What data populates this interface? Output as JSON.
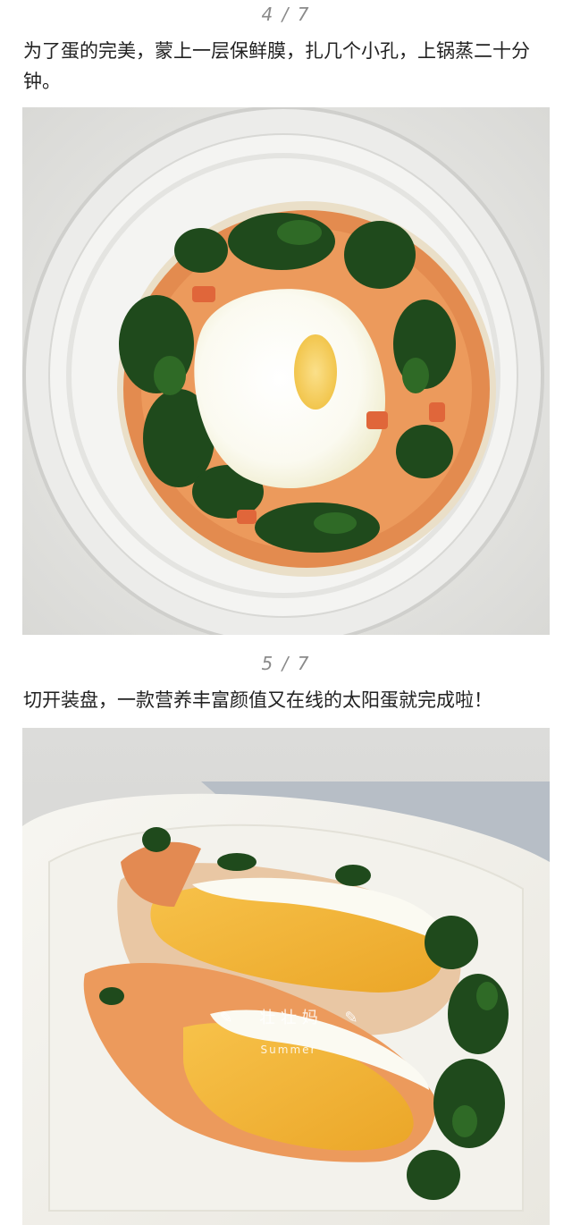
{
  "steps": [
    {
      "counter": "4 / 7",
      "text": "为了蛋的完美，蒙上一层保鲜膜，扎几个小孔，上锅蒸二十分钟。",
      "photo": "bowl-of-steamed-egg-with-spinach-and-carrot"
    },
    {
      "counter": "5 / 7",
      "text": "切开装盘，一款营养丰富颜值又在线的太阳蛋就完成啦！",
      "photo": "plated-sliced-sun-egg",
      "watermark": {
        "name": "壮 壮 妈",
        "sub": "Summer"
      }
    }
  ],
  "colors": {
    "spinach": "#1f4a1c",
    "carrot": "#e0763a",
    "yolk": "#f0b020",
    "egg_white": "#fbfaf2",
    "counter": "#8a8a8a"
  }
}
